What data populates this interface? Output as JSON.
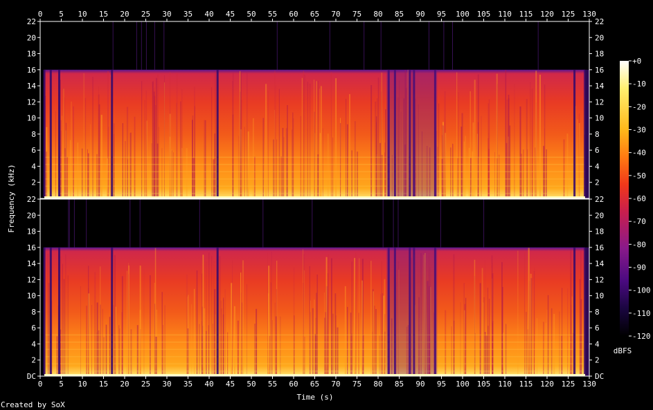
{
  "chart_data": {
    "type": "heatmap",
    "title": "",
    "xlabel": "Time (s)",
    "ylabel": "Frequency (kHz)",
    "x_ticks": [
      "0",
      "5",
      "10",
      "15",
      "20",
      "25",
      "30",
      "35",
      "40",
      "45",
      "50",
      "55",
      "60",
      "65",
      "70",
      "75",
      "80",
      "85",
      "90",
      "95",
      "100",
      "105",
      "110",
      "115",
      "120",
      "125",
      "130"
    ],
    "xlim": [
      0,
      130
    ],
    "y_ticks_top": [
      "22",
      "20",
      "18",
      "16",
      "14",
      "12",
      "10",
      "8",
      "6",
      "4",
      "2"
    ],
    "y_ticks_bottom": [
      "22",
      "20",
      "18",
      "16",
      "14",
      "12",
      "10",
      "8",
      "6",
      "4",
      "2",
      "DC"
    ],
    "ylim_khz": [
      0,
      22
    ],
    "channels": 2,
    "lowpass_cutoff_khz": 16,
    "dropouts_seconds": [
      1,
      2.5,
      4.5,
      17,
      42,
      82.5,
      84,
      87.5,
      88.5,
      93.5,
      126.5
    ],
    "colorbar": {
      "ticks": [
        "+0",
        "-10",
        "-20",
        "-30",
        "-40",
        "-50",
        "-60",
        "-70",
        "-80",
        "-90",
        "-100",
        "-110",
        "-120"
      ],
      "range_dbfs": [
        -120,
        0
      ],
      "unit": "dBFS"
    },
    "colormap": [
      "#000000",
      "#1a0640",
      "#4a0a80",
      "#8a1a8a",
      "#c81e4e",
      "#f0381a",
      "#ff7a12",
      "#ffb81a",
      "#fff070",
      "#ffffff"
    ]
  },
  "footer": "Created by SoX"
}
